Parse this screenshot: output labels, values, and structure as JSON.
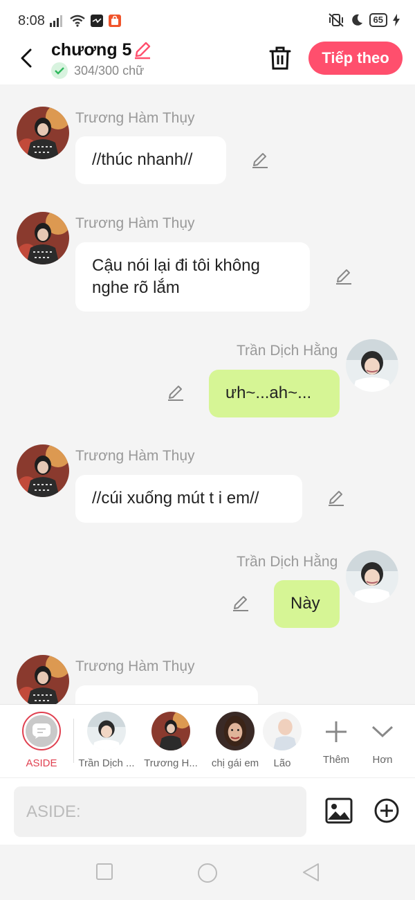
{
  "status": {
    "time": "8:08",
    "battery": "65"
  },
  "header": {
    "title": "chương 5",
    "word_count": "304/300 chữ",
    "next_label": "Tiếp theo"
  },
  "messages": [
    {
      "sender": "Trương Hàm Thụy",
      "text": "//thúc nhanh//",
      "side": "left"
    },
    {
      "sender": "Trương Hàm Thụy",
      "text": "Cậu nói lại đi tôi không nghe rõ lắm",
      "side": "left"
    },
    {
      "sender": "Trần Dịch Hằng",
      "text": "ưh~...ah~...",
      "side": "right"
    },
    {
      "sender": "Trương Hàm Thụy",
      "text": "//cúi xuống mút t i em//",
      "side": "left"
    },
    {
      "sender": "Trần Dịch Hằng",
      "text": "Này",
      "side": "right"
    },
    {
      "sender": "Trương Hàm Thụy",
      "text": "",
      "side": "left"
    }
  ],
  "characters": [
    {
      "label": "ASIDE"
    },
    {
      "label": "Trần Dịch ..."
    },
    {
      "label": "Trương H..."
    },
    {
      "label": "chị gái em"
    },
    {
      "label": "Lão"
    }
  ],
  "char_actions": {
    "add_label": "Thêm",
    "more_label": "Hơn"
  },
  "input": {
    "placeholder": "ASIDE:"
  },
  "colors": {
    "accent": "#ff4f6d",
    "self_bubble": "#d6f595",
    "other_bubble": "#ffffff"
  }
}
